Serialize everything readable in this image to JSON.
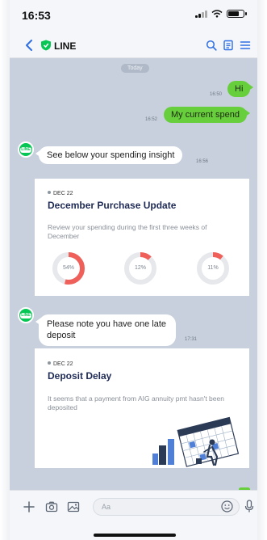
{
  "status_bar": {
    "time": "16:53"
  },
  "nav": {
    "title": "LINE",
    "icons": [
      "chevron-left-icon",
      "shield-logo-icon",
      "search-icon",
      "notes-icon",
      "menu-icon"
    ]
  },
  "chat": {
    "date_divider": "Today",
    "messages": [
      {
        "text": "Hi",
        "time": "16:50"
      },
      {
        "text": "My current spend",
        "time": "16:52"
      },
      {
        "text": "See below your spending insight",
        "time": "16:56"
      },
      {
        "text": "Please note you have one late deposit",
        "time": "17:31"
      }
    ],
    "avatar_text": "LINE",
    "cards": [
      {
        "date": "DEC 22",
        "title": "December Purchase Update",
        "body": "Review your spending during the first three weeks of December",
        "donuts": [
          {
            "label": "54%",
            "value": 0.54
          },
          {
            "label": "12%",
            "value": 0.12
          },
          {
            "label": "11%",
            "value": 0.11
          }
        ]
      },
      {
        "date": "DEC 22",
        "title": "Deposit Delay",
        "body": "It seems that a payment from AIG annuity pmt hasn't been deposited",
        "illustration": "calendar-person-illustration"
      }
    ]
  },
  "composer": {
    "placeholder": "Aa",
    "icons": [
      "plus-icon",
      "camera-icon",
      "image-icon",
      "emoji-icon",
      "microphone-icon"
    ]
  },
  "colors": {
    "accent_green": "#06c755",
    "bubble_green": "#67cf3c",
    "chat_background": "#c7d0dc",
    "nav_blue": "#2f6fe3",
    "donut_red": "#f0605a",
    "donut_track": "#e6e8eb"
  }
}
